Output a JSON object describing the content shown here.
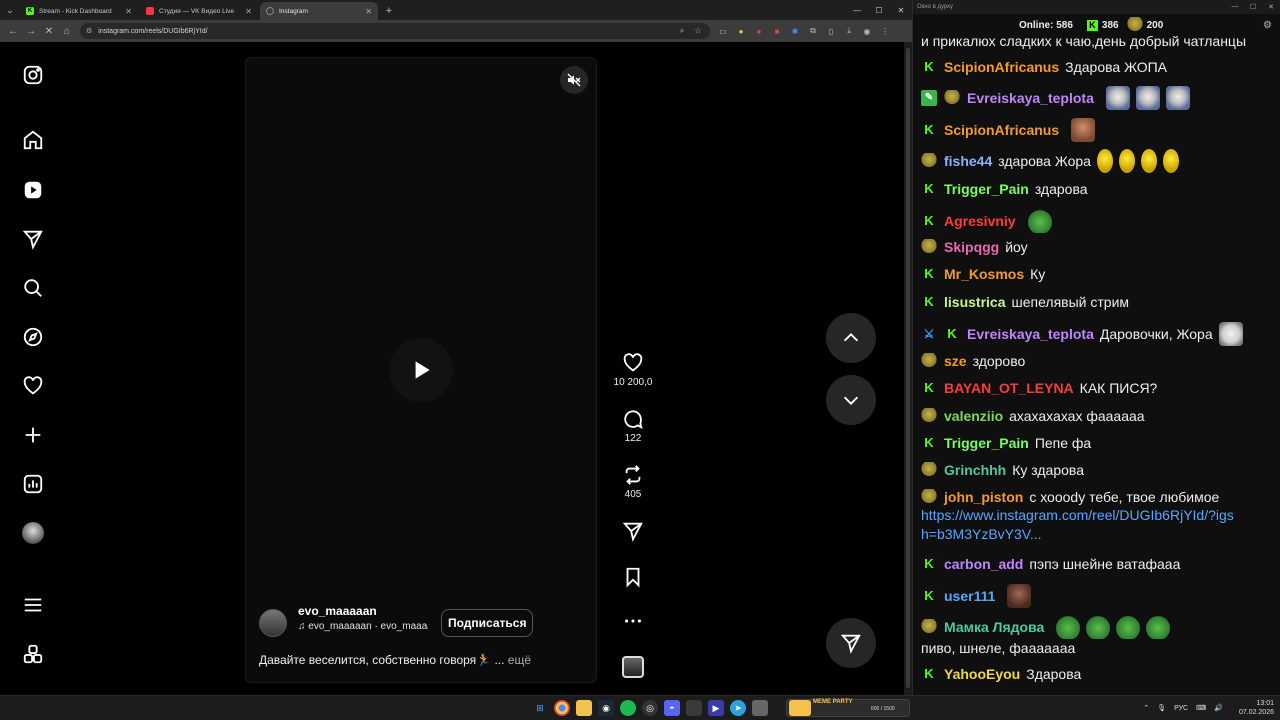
{
  "browser": {
    "tabs": [
      {
        "title": "Stream - Kick Dashboard",
        "icon": "K",
        "icon_color": "#53fc18"
      },
      {
        "title": "Студия — VK Видео Live",
        "icon": "vk",
        "icon_color": "#ff3347"
      },
      {
        "title": "Instagram",
        "icon": "",
        "icon_color": "#888888"
      }
    ],
    "url": "instagram.com/reels/DUGIb6RjYId/"
  },
  "reel": {
    "username": "evo_maaaaan",
    "audio": "evo_maaaaan · evo_maaaaan",
    "follow_label": "Подписаться",
    "caption": "Давайте веселится, собственно говоря🏃 ...",
    "caption_more": "ещё",
    "likes": "10 200,0",
    "comments": "122",
    "reposts": "405"
  },
  "chat": {
    "window_title": "Окно в дурку",
    "online_label": "Online:",
    "online_count": "586",
    "stat_kick": "386",
    "stat_other": "200",
    "top_text": "и прикалюх сладких к чаю,день добрый чатланцы",
    "messages": [
      {
        "badges": [
          "kick"
        ],
        "user": "ScipionAfricanus",
        "color": "#f59a2b",
        "text": "Здарова ЖОПА",
        "emotes": []
      },
      {
        "badges": [
          "green",
          "pepe"
        ],
        "user": "Evreiskaya_teplota",
        "color": "#c084ff",
        "text": "",
        "emotes": [
          "cat",
          "cat",
          "cat"
        ]
      },
      {
        "badges": [
          "kick"
        ],
        "user": "ScipionAfricanus",
        "color": "#f59a2b",
        "text": "",
        "emotes": [
          "face"
        ]
      },
      {
        "badges": [
          "pepe"
        ],
        "user": "fishe44",
        "color": "#8ab4ff",
        "text": "здарова Жора",
        "emotes": [
          "yellow",
          "yellow",
          "yellow",
          "yellow"
        ]
      },
      {
        "badges": [
          "kick"
        ],
        "user": "Trigger_Pain",
        "color": "#7cfc63",
        "text": "здарова",
        "emotes": []
      },
      {
        "badges": [
          "kick"
        ],
        "user": "Agresivniy",
        "color": "#ff3b3b",
        "text": "",
        "emotes": [
          "frog"
        ]
      },
      {
        "badges": [
          "pepe"
        ],
        "user": "Skipqgg",
        "color": "#e86bb0",
        "text": "йоу",
        "emotes": []
      },
      {
        "badges": [
          "kick"
        ],
        "user": "Mr_Kosmos",
        "color": "#f59a2b",
        "text": "Ку",
        "emotes": []
      },
      {
        "badges": [
          "kick"
        ],
        "user": "lisustrica",
        "color": "#c8f58a",
        "text": "шепелявый стрим",
        "emotes": []
      },
      {
        "badges": [
          "sword",
          "kick"
        ],
        "user": "Evreiskaya_teplota",
        "color": "#c084ff",
        "text": "Даровочки, Жора",
        "emotes": [
          "catw"
        ]
      },
      {
        "badges": [
          "pepe"
        ],
        "user": "sze",
        "color": "#f59a2b",
        "text": "здорово",
        "emotes": []
      },
      {
        "badges": [
          "kick"
        ],
        "user": "BAYAN_OT_LEYNA",
        "color": "#ff3b3b",
        "text": "КАК ПИСЯ?",
        "emotes": []
      },
      {
        "badges": [
          "pepe"
        ],
        "user": "valenziio",
        "color": "#7ed957",
        "text": "ахахахахах фаааааа",
        "emotes": []
      },
      {
        "badges": [
          "kick"
        ],
        "user": "Trigger_Pain",
        "color": "#7cfc63",
        "text": "Пепе фа",
        "emotes": []
      },
      {
        "badges": [
          "pepe"
        ],
        "user": "Grinchhh",
        "color": "#4ec9a0",
        "text": "Ку здарова",
        "emotes": []
      },
      {
        "badges": [
          "pepe"
        ],
        "user": "john_piston",
        "color": "#f59a2b",
        "text": "с хооody тебе, твое любимое",
        "emotes": [],
        "link": "https://www.instagram.com/reel/DUGIb6RjYId/?igsh=b3M3YzBvY3V..."
      },
      {
        "badges": [
          "kick"
        ],
        "user": "carbon_add",
        "color": "#c084ff",
        "text": "пэпэ шнейне ватафааа",
        "emotes": []
      },
      {
        "badges": [
          "kick"
        ],
        "user": "user111",
        "color": "#58a6ff",
        "text": "",
        "emotes": [
          "man"
        ]
      },
      {
        "badges": [
          "pepe"
        ],
        "user": "Мамка Лядова",
        "color": "#4ec9a0",
        "text": "пиво, шнеле, фааааааа",
        "emotes": [
          "frog",
          "frog",
          "frog",
          "frog"
        ]
      },
      {
        "badges": [
          "kick"
        ],
        "user": "YahooEyou",
        "color": "#f5d742",
        "text": "Здарова",
        "emotes": []
      }
    ]
  },
  "taskbar": {
    "event_title": "MEME PARTY",
    "event_progress": "600 / 1500",
    "lang": "РУС",
    "time": "13:01",
    "date": "07.02.2026"
  }
}
